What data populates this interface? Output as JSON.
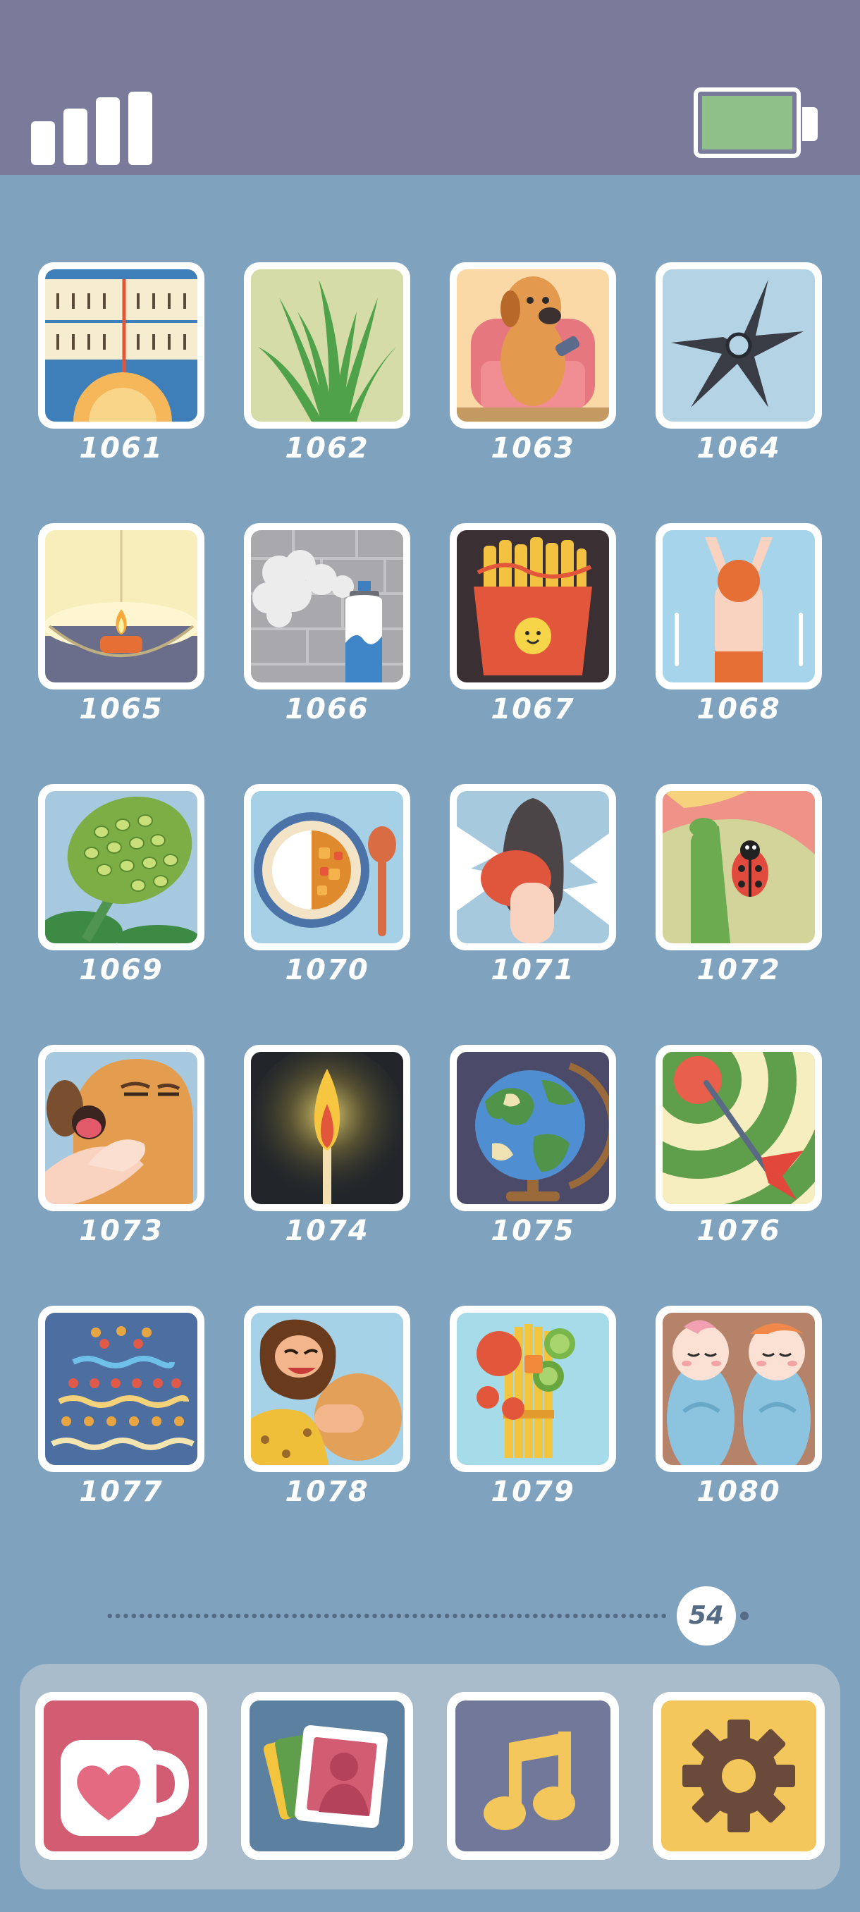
{
  "status_bar": {
    "signal_icon": "signal-bars-icon",
    "battery_icon": "battery-icon",
    "battery_color": "#8fc08a"
  },
  "levels": [
    {
      "number": "1061",
      "icon": "thermometer-ruler-icon"
    },
    {
      "number": "1062",
      "icon": "green-grass-icon"
    },
    {
      "number": "1063",
      "icon": "dog-armchair-remote-icon"
    },
    {
      "number": "1064",
      "icon": "ninja-star-icon"
    },
    {
      "number": "1065",
      "icon": "candle-bowl-icon"
    },
    {
      "number": "1066",
      "icon": "spray-can-icon"
    },
    {
      "number": "1067",
      "icon": "french-fries-icon"
    },
    {
      "number": "1068",
      "icon": "swimmer-icon"
    },
    {
      "number": "1069",
      "icon": "lotus-seed-pod-icon"
    },
    {
      "number": "1070",
      "icon": "curry-rice-icon"
    },
    {
      "number": "1071",
      "icon": "boxing-glove-icon"
    },
    {
      "number": "1072",
      "icon": "ladybug-icon"
    },
    {
      "number": "1073",
      "icon": "dog-yawning-icon"
    },
    {
      "number": "1074",
      "icon": "lit-match-icon"
    },
    {
      "number": "1075",
      "icon": "globe-icon"
    },
    {
      "number": "1076",
      "icon": "dart-target-icon"
    },
    {
      "number": "1077",
      "icon": "patterned-cake-icon"
    },
    {
      "number": "1078",
      "icon": "caveman-stone-icon"
    },
    {
      "number": "1079",
      "icon": "fruit-bundle-icon"
    },
    {
      "number": "1080",
      "icon": "swaddled-babies-icon"
    }
  ],
  "pagination": {
    "current_page": "54"
  },
  "dock": [
    {
      "icon": "heart-mug-icon",
      "color": "#d25c71"
    },
    {
      "icon": "photo-album-icon",
      "color": "#5b80a0"
    },
    {
      "icon": "music-note-icon",
      "color": "#72789a"
    },
    {
      "icon": "gear-icon",
      "color": "#f4c75c"
    }
  ]
}
